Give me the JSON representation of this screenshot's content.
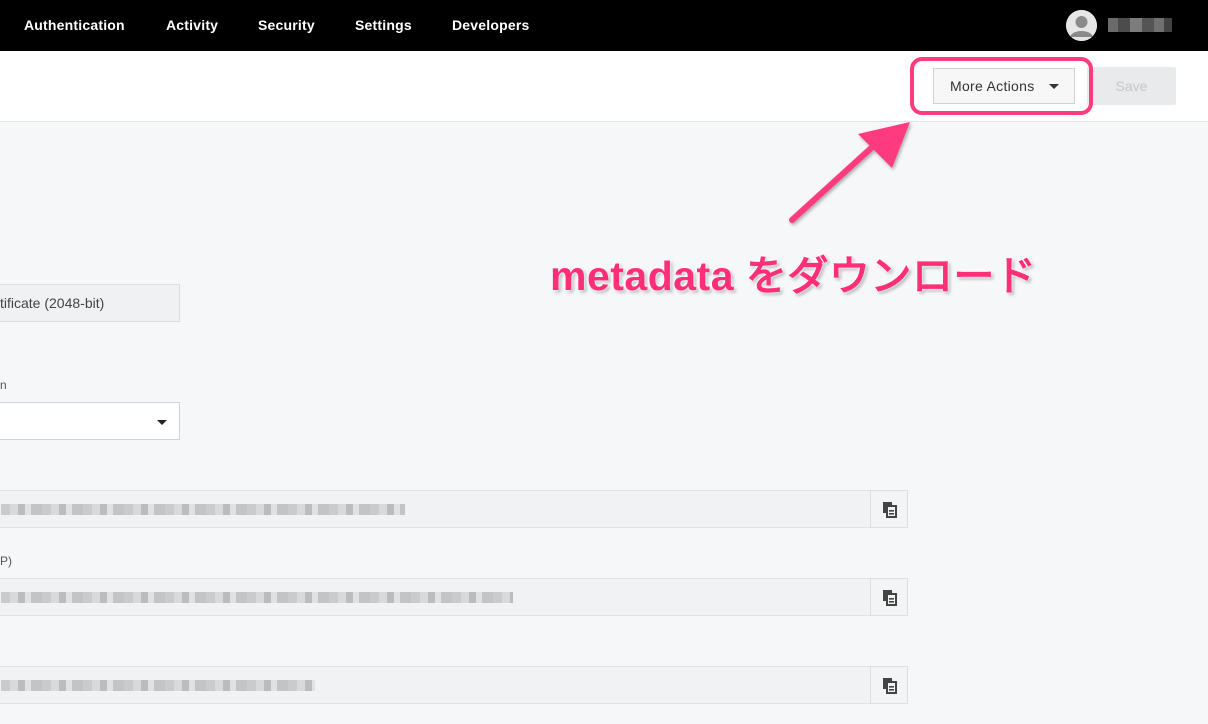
{
  "nav": {
    "items": [
      {
        "label": "Authentication"
      },
      {
        "label": "Activity"
      },
      {
        "label": "Security"
      },
      {
        "label": "Settings"
      },
      {
        "label": "Developers"
      }
    ]
  },
  "toolbar": {
    "more_actions_label": "More Actions",
    "save_label": "Save"
  },
  "annotation": {
    "text": "metadata をダウンロード",
    "color": "#ff2e78"
  },
  "form": {
    "certificate_value": "tificate (2048-bit)",
    "select_label_fragment": "n",
    "field2_label_fragment": "P)"
  },
  "colors": {
    "nav_bg": "#000000",
    "highlight": "#ff3b7f",
    "save_disabled_text": "#c4c6c8"
  }
}
